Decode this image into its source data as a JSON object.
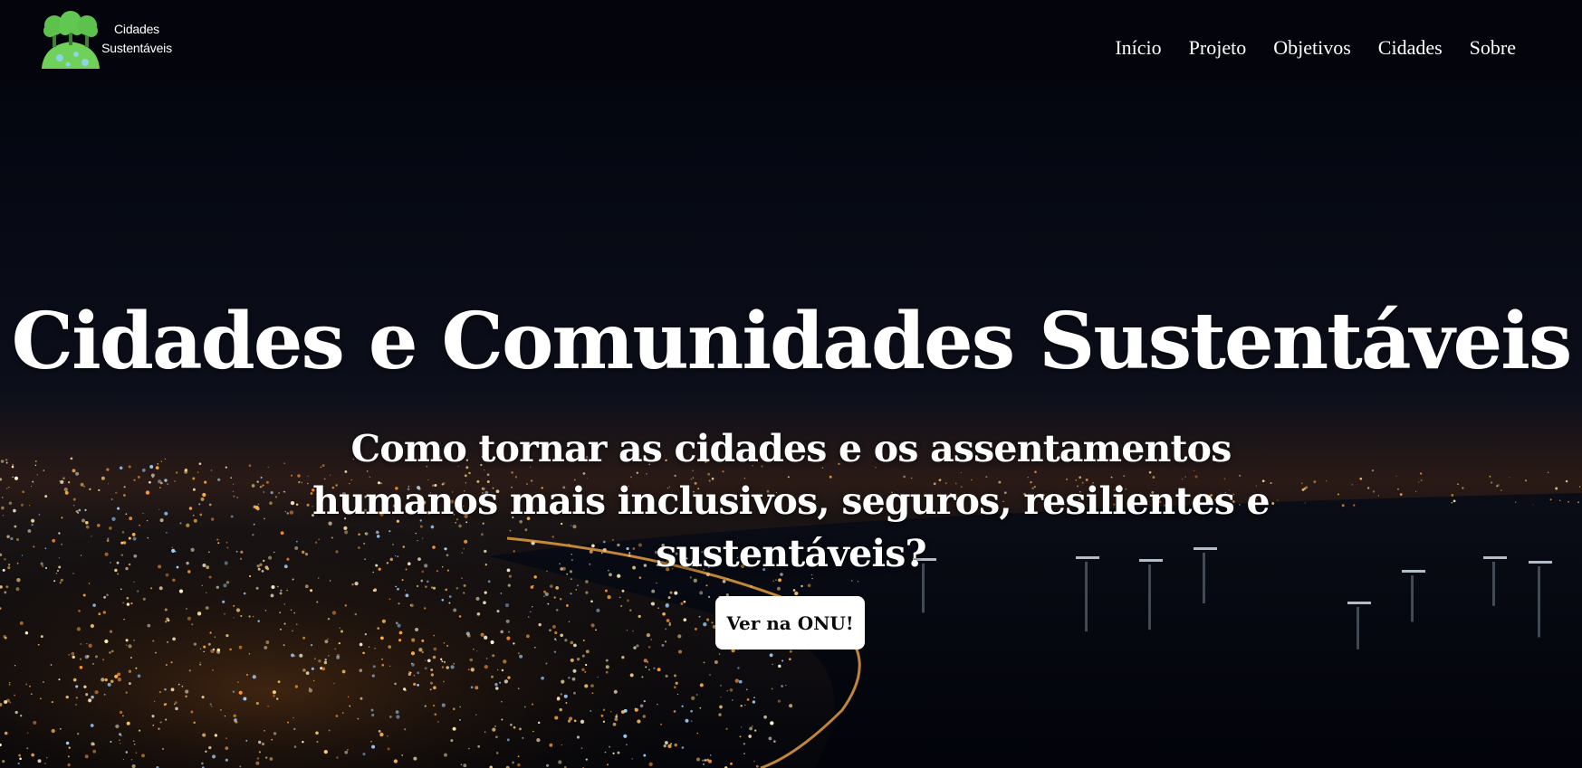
{
  "header": {
    "logo": {
      "line1": "Cidades",
      "line2": "Sustentáveis",
      "icon": "tree-globe-icon"
    },
    "nav": [
      "Início",
      "Projeto",
      "Objetivos",
      "Cidades",
      "Sobre"
    ]
  },
  "hero": {
    "title": "Cidades e Comunidades Sustentáveis",
    "subtitle": "Como tornar as cidades e os assentamentos humanos mais inclusivos, seguros, resilientes e sustentáveis?",
    "button_label": "Ver na ONU!",
    "background": "night-city-skyline-image"
  },
  "colors": {
    "header_bg": "#04050c",
    "text": "#ffffff",
    "logo_green": "#5fc64f",
    "logo_blue": "#7fc4d8",
    "city_light": "#ffb347"
  }
}
